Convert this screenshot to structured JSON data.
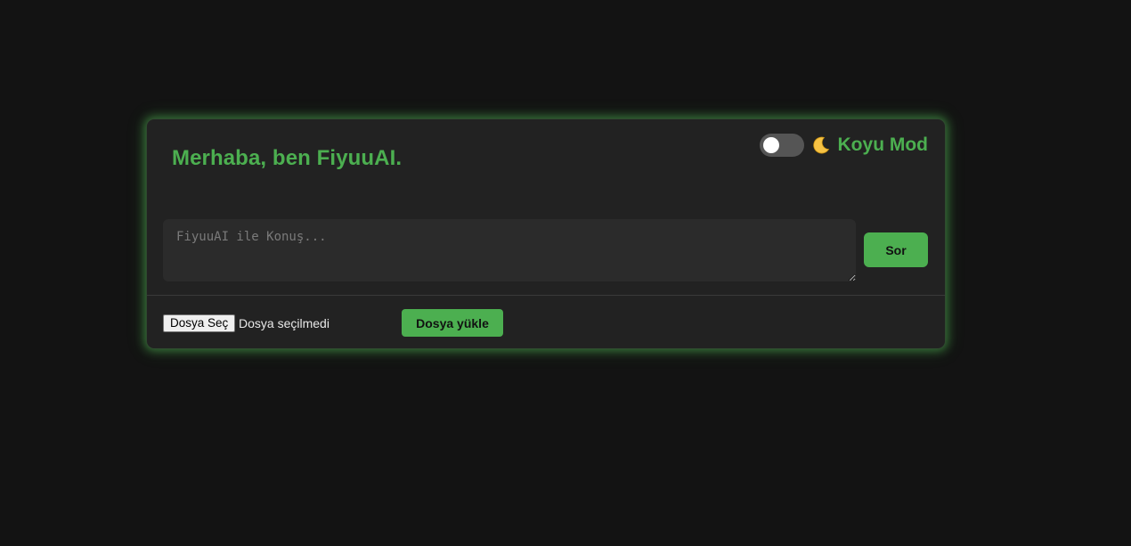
{
  "header": {
    "greeting": "Merhaba, ben FiyuuAI."
  },
  "theme_toggle": {
    "icon": "moon-icon",
    "label": "Koyu Mod",
    "enabled": false
  },
  "chat": {
    "placeholder": "FiyuuAI ile Konuş...",
    "value": "",
    "ask_label": "Sor"
  },
  "upload": {
    "choose_label": "Dosya Seç",
    "status_text": "Dosya seçilmedi",
    "upload_label": "Dosya yükle"
  },
  "colors": {
    "accent": "#4caf50",
    "background": "#131313",
    "card": "#222222",
    "input": "#2b2b2b",
    "toggle_track": "#555555"
  }
}
